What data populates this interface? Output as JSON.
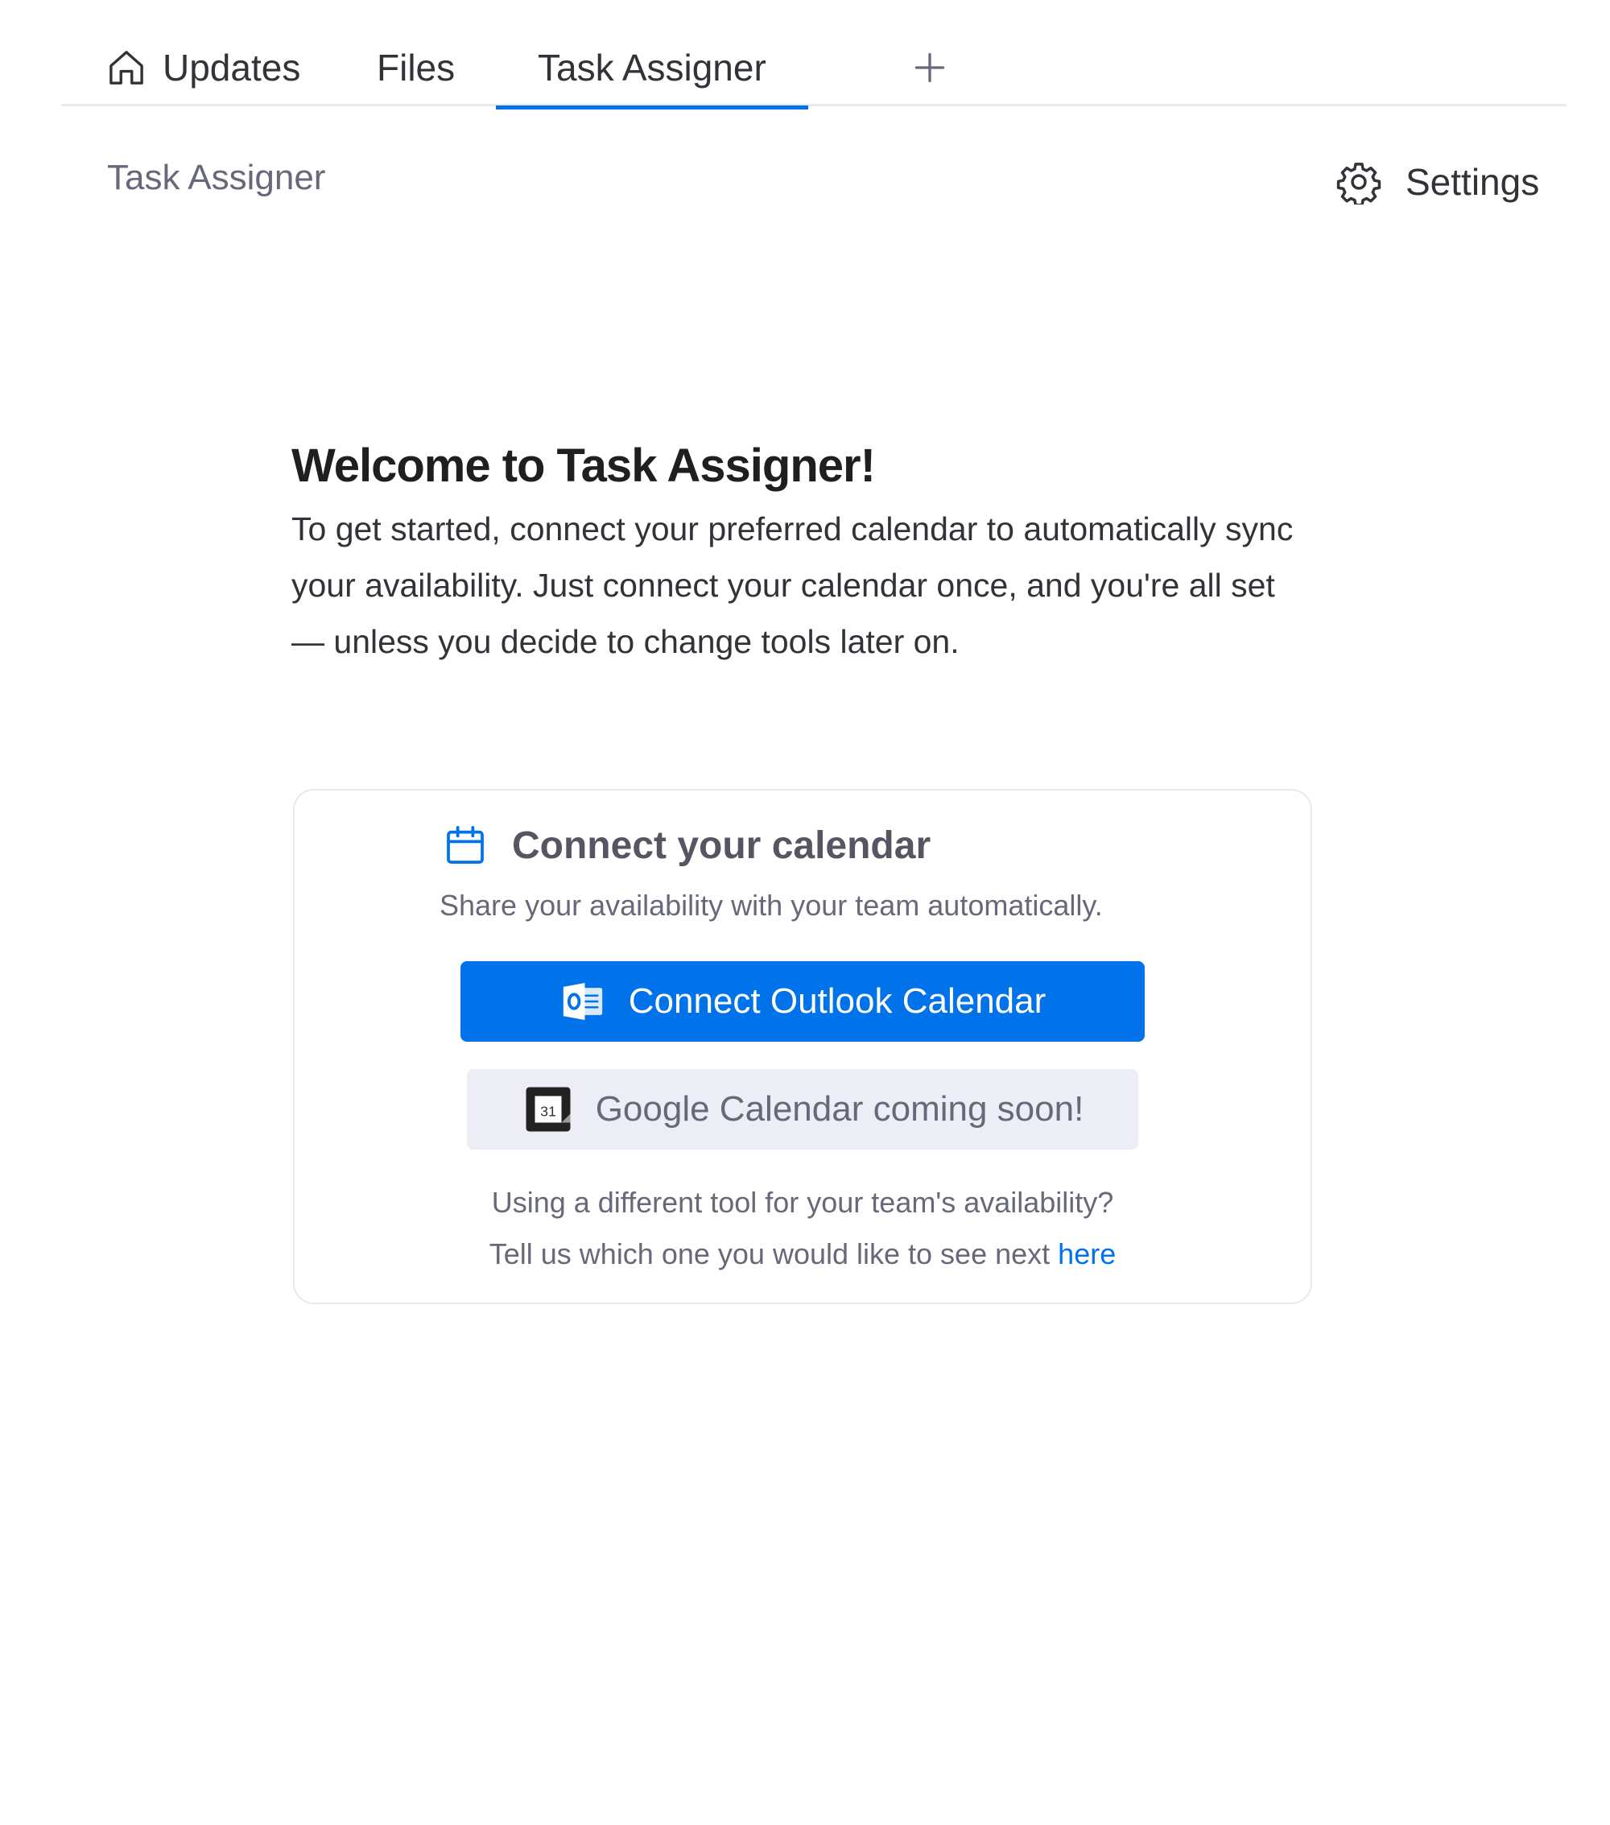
{
  "tabs": {
    "updates": "Updates",
    "files": "Files",
    "task_assigner": "Task Assigner"
  },
  "header": {
    "title": "Task Assigner",
    "settings_label": "Settings"
  },
  "welcome": {
    "title": "Welcome to Task Assigner!",
    "description": "To get started, connect your preferred calendar to automatically sync your availability. Just connect your calendar once, and you're all set — unless you decide to change tools later on."
  },
  "card": {
    "title": "Connect your calendar",
    "subtitle": "Share your availability with your team automatically.",
    "outlook_button": "Connect Outlook Calendar",
    "google_button": "Google Calendar coming soon!",
    "footer_line1": "Using a different tool for your team's availability?",
    "footer_line2": "Tell us which one you would like to see next",
    "footer_link": "here"
  },
  "colors": {
    "accent": "#0073ea",
    "tab_border": "#e6e9ef",
    "disabled_bg": "#ecedf5"
  }
}
